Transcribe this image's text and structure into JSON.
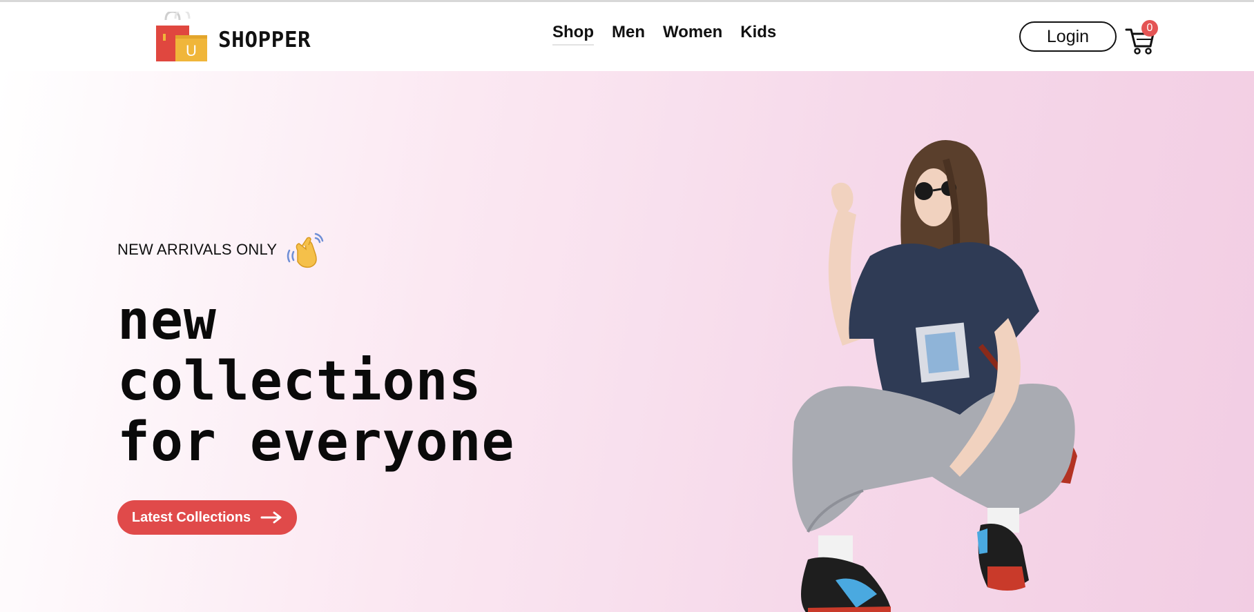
{
  "brand": {
    "name": "SHOPPER",
    "logo_icon": "shopping-bags-icon",
    "logo_letter": "U"
  },
  "nav": {
    "items": [
      {
        "label": "Shop",
        "active": true
      },
      {
        "label": "Men",
        "active": false
      },
      {
        "label": "Women",
        "active": false
      },
      {
        "label": "Kids",
        "active": false
      }
    ],
    "login_label": "Login",
    "cart_icon": "cart-icon",
    "cart_count": "0"
  },
  "hero": {
    "tagline": "NEW ARRIVALS ONLY",
    "tagline_icon": "waving-hand-icon",
    "headline_lines": [
      "new",
      "collections",
      "for everyone"
    ],
    "cta_label": "Latest Collections",
    "cta_icon": "arrow-right-icon",
    "image": "hero-model-image"
  },
  "colors": {
    "accent": "#e04a4a",
    "cart_badge": "#e45454",
    "hero_gradient_start": "#ffffff",
    "hero_gradient_end": "#f2cde3"
  }
}
